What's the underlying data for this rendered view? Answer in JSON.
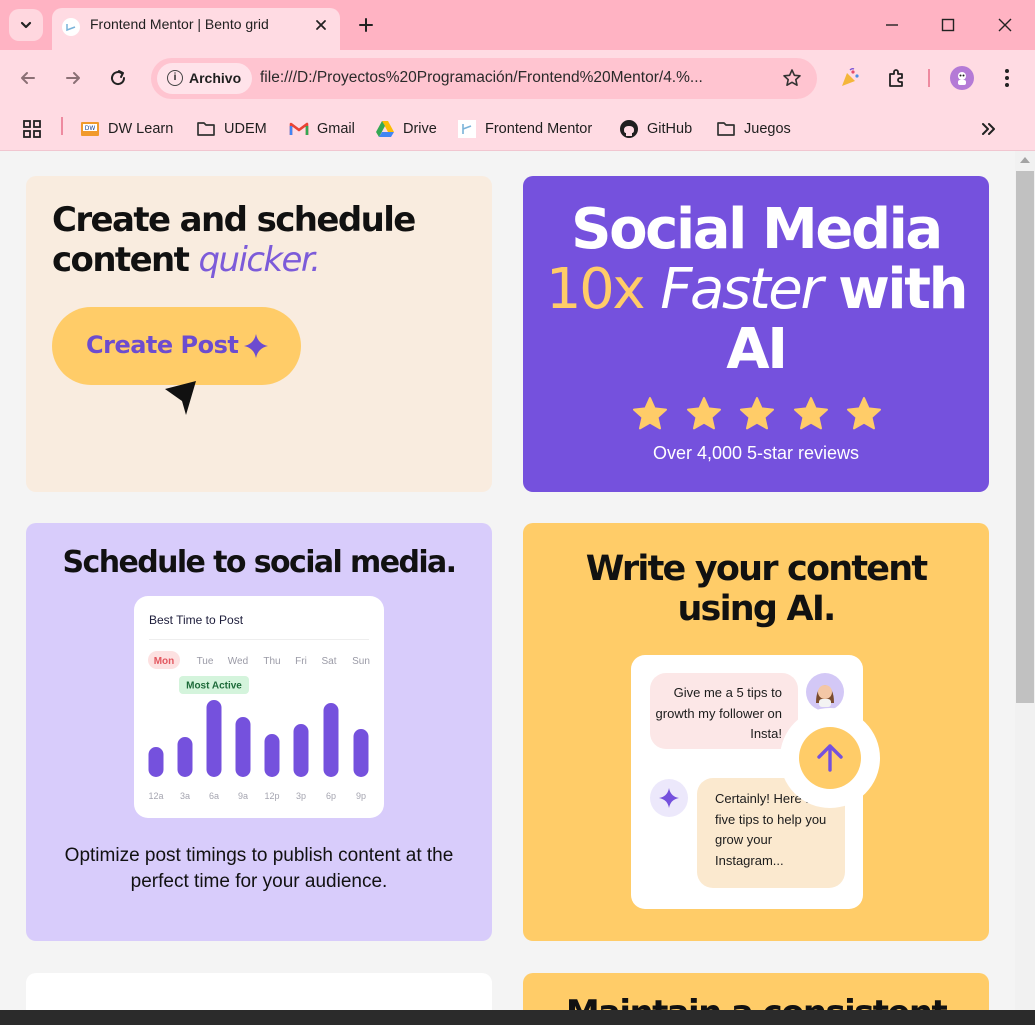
{
  "browser": {
    "tab_title": "Frontend Mentor | Bento grid",
    "site_chip": "Archivo",
    "url": "file:///D:/Proyectos%20Programación/Frontend%20Mentor/4.%...",
    "bookmarks": [
      {
        "label": "DW Learn",
        "icon": "dw-learn-icon"
      },
      {
        "label": "UDEM",
        "icon": "folder-icon"
      },
      {
        "label": "Gmail",
        "icon": "gmail-icon"
      },
      {
        "label": "Drive",
        "icon": "drive-icon"
      },
      {
        "label": "Frontend Mentor",
        "icon": "frontend-mentor-icon"
      },
      {
        "label": "GitHub",
        "icon": "github-icon"
      },
      {
        "label": "Juegos",
        "icon": "folder-icon"
      }
    ]
  },
  "colors": {
    "purple": "#7551dd",
    "yellow": "#ffcc68",
    "lavender": "#d8ccfb",
    "cream": "#f9ecdf",
    "chrome_pink": "#ffb3c3"
  },
  "card_create": {
    "title_line1": "Create and schedule",
    "title_line2": "content",
    "title_accent": "quicker.",
    "button_label": "Create Post"
  },
  "card_hero": {
    "line1": "Social Media",
    "highlight": "10x",
    "italic": "Faster",
    "rest": "with",
    "line3": "AI",
    "stars": 5,
    "reviews": "Over 4,000 5-star reviews"
  },
  "card_schedule": {
    "title": "Schedule to social media.",
    "chart_title": "Best Time to Post",
    "days": [
      "Mon",
      "Tue",
      "Wed",
      "Thu",
      "Fri",
      "Sat",
      "Sun"
    ],
    "active_day": "Mon",
    "badge": "Most Active",
    "times": [
      "12a",
      "3a",
      "6a",
      "9a",
      "12p",
      "3p",
      "6p",
      "9p"
    ],
    "activity": [
      30,
      40,
      77,
      60,
      43,
      53,
      74,
      48
    ],
    "description": "Optimize post timings to publish content at the perfect time for your audience."
  },
  "card_ai": {
    "title": "Write your content using AI.",
    "user_message": "Give me a 5 tips to growth my follower on Insta!",
    "ai_message": "Certainly! Here are five tips to help you grow your Instagram..."
  },
  "card_consistent": {
    "title": "Maintain a consistent posting"
  }
}
